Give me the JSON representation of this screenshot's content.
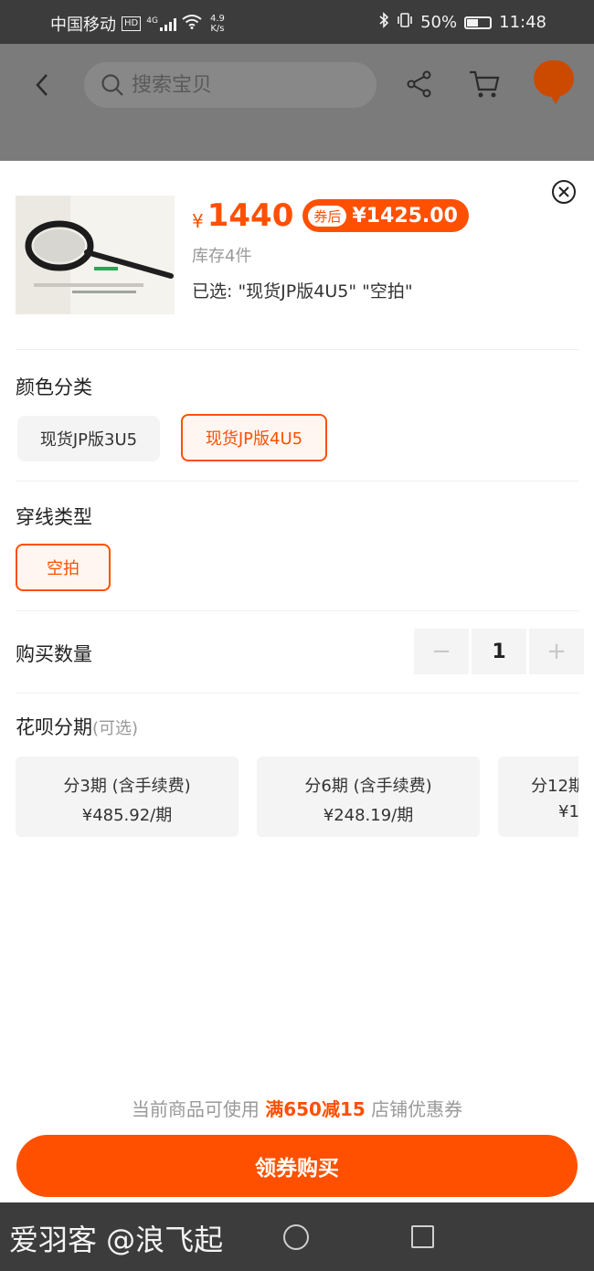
{
  "status_bar": {
    "carrier": "中国移动",
    "hd_badge": "HD",
    "network": "4G",
    "speed_value": "4.9",
    "speed_unit": "K/s",
    "battery_percent": "50%",
    "battery_level": 0.5,
    "time": "11:48"
  },
  "nav": {
    "search_placeholder": "搜索宝贝"
  },
  "product": {
    "currency": "¥",
    "price": "1440",
    "coupon_label": "券后",
    "coupon_price": "¥1425.00",
    "stock": "库存4件",
    "selected": "已选: \"现货JP版4U5\" \"空拍\""
  },
  "color_section": {
    "title": "颜色分类",
    "options": [
      {
        "label": "现货JP版3U5",
        "selected": false
      },
      {
        "label": "现货JP版4U5",
        "selected": true
      }
    ]
  },
  "string_section": {
    "title": "穿线类型",
    "options": [
      {
        "label": "空拍",
        "selected": true
      }
    ]
  },
  "quantity": {
    "label": "购买数量",
    "minus": "−",
    "value": "1",
    "plus": "+"
  },
  "huabei": {
    "title": "花呗分期",
    "note": "(可选)",
    "plans": [
      {
        "period": "分3期 (含手续费)",
        "amount": "¥485.92/期"
      },
      {
        "period": "分6期 (含手续费)",
        "amount": "¥248.19/期"
      },
      {
        "period": "分12期",
        "amount": "¥1"
      }
    ]
  },
  "promo": {
    "prefix": "当前商品可使用 ",
    "highlight": "满650减15",
    "suffix": " 店铺优惠券"
  },
  "buy_button": "领券购买",
  "watermark": "爱羽客 @浪飞起",
  "colors": {
    "accent": "#ff5000",
    "status_bar": "#3c3c3c",
    "overlay": "#7b7b7b"
  }
}
